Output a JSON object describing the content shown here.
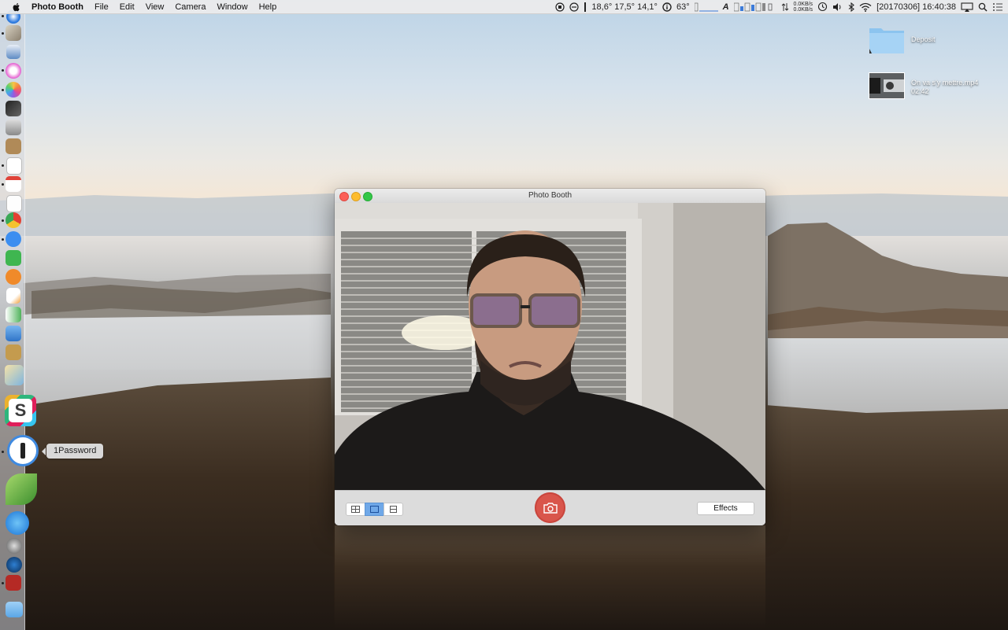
{
  "menubar": {
    "app_name": "Photo Booth",
    "items": [
      "File",
      "Edit",
      "View",
      "Camera",
      "Window",
      "Help"
    ],
    "temperatures": "18,6°  17,5°  14,1°",
    "battery_temp": "63°",
    "keyboard_letter": "A",
    "net_up": "0.0KB/s",
    "net_down": "0.0KB/s",
    "datetime": "[20170306] 16:40:38"
  },
  "dock": {
    "tooltip": "1Password",
    "icons": [
      "safari-icon",
      "cube-icon",
      "preview-icon",
      "itunes-icon",
      "photos-icon",
      "final-cut-icon",
      "keynote-icon",
      "notes-icon",
      "document-icon",
      "calendar-icon",
      "textedit-icon",
      "chrome-icon",
      "messages-icon",
      "facetime-icon",
      "ibooks-icon",
      "pages-icon",
      "numbers-icon",
      "keynote2-icon",
      "archive-icon",
      "preview2-icon",
      "slack-icon",
      "1password-icon",
      "coda-icon",
      "app-store-icon",
      "system-preferences-icon",
      "quicktime-icon",
      "photo-booth-icon",
      "downloads-folder-icon"
    ]
  },
  "desktop": {
    "folder_label": "Deposit",
    "video_label": "On va s'y mettre.mp4",
    "video_duration": "02:42"
  },
  "window": {
    "title": "Photo Booth",
    "effects_label": "Effects"
  },
  "colors": {
    "shutter": "#d9554b",
    "close": "#fc5f57",
    "minimize": "#fdbc2e",
    "zoom": "#33c748",
    "selected_view": "#6fa8e8"
  }
}
